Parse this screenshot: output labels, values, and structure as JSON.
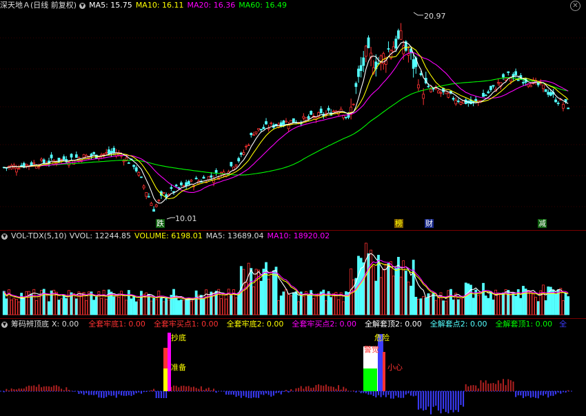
{
  "price_panel": {
    "title": "深天地Ａ(日线 前复权)",
    "ma5_label": "MA5: 15.75",
    "ma10_label": "MA10: 16.11",
    "ma20_label": "MA20: 16.36",
    "ma60_label": "MA60: 16.49",
    "high_mark": "20.97",
    "low_mark": "10.01",
    "tags": [
      "跌",
      "榜",
      "财",
      "减"
    ],
    "colors": {
      "ma5": "#ffffff",
      "ma10": "#ffff00",
      "ma20": "#ff00ff",
      "ma60": "#00ff00",
      "up": "#ff3232",
      "down": "#54ffff"
    }
  },
  "volume_panel": {
    "title": "VOL-TDX(5,10)",
    "vvol_label": "VVOL: 12244.85",
    "volume_label": "VOLUME: 6198.01",
    "ma5_label": "MA5: 13689.04",
    "ma10_label": "MA10: 18920.02"
  },
  "indicator_panel": {
    "title": "筹码辨顶底",
    "x_label": "X: 0.00",
    "items": [
      {
        "label": "全套牢底1: 0.00",
        "color": "#ff3232"
      },
      {
        "label": "全套牢买点1: 0.00",
        "color": "#ff3232"
      },
      {
        "label": "全套牢底2: 0.00",
        "color": "#ffff00"
      },
      {
        "label": "全套牢买点2: 0.00",
        "color": "#ff00ff"
      },
      {
        "label": "全解套顶2: 0.00",
        "color": "#ffffff"
      },
      {
        "label": "全解套点2: 0.00",
        "color": "#54ffff"
      },
      {
        "label": "全解套顶1: 0.00",
        "color": "#00ff00"
      },
      {
        "label": "全",
        "color": "#3c3cff"
      }
    ],
    "signals": {
      "chaodi": "抄底",
      "zhunbei": "准备",
      "weixian": "危险",
      "jingjue": "警觉",
      "xiaoxin": "小心"
    }
  },
  "chart_data": {
    "type": "candlestick",
    "price_range": [
      9.4,
      22.0
    ],
    "high": 20.97,
    "low": 10.01,
    "ma_last": {
      "MA5": 15.75,
      "MA10": 16.11,
      "MA20": 16.36,
      "MA60": 16.49
    },
    "volume_last": {
      "VVOL": 12244.85,
      "VOLUME": 6198.01,
      "MA5": 13689.04,
      "MA10": 18920.02
    }
  },
  "window_controls": {
    "close_icon": "close-icon"
  }
}
